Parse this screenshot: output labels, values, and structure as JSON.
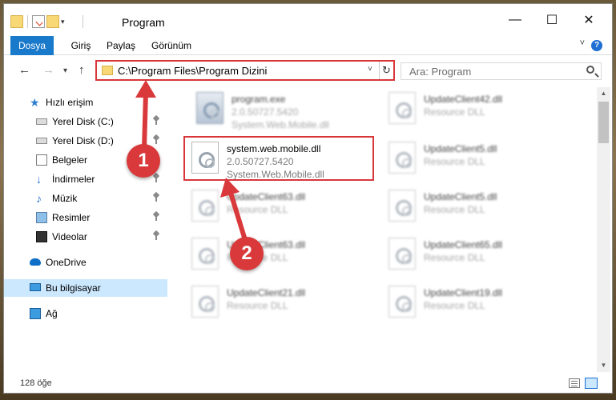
{
  "window": {
    "title": "Program",
    "controls": {
      "minimize": "—",
      "maximize": "☐",
      "close": "✕"
    }
  },
  "ribbon": {
    "tabs": [
      "Dosya",
      "Giriş",
      "Paylaş",
      "Görünüm"
    ],
    "expand_glyph": "˅",
    "help_glyph": "?"
  },
  "navbar": {
    "back": "←",
    "forward": "→",
    "recent": "▾",
    "up": "↑",
    "address": "C:\\Program Files\\Program Dizini",
    "address_dropdown": "˅",
    "refresh": "↻",
    "search_placeholder": "Ara: Program"
  },
  "sidebar": {
    "items": [
      {
        "label": "Hızlı erişim",
        "icon": "star-icon",
        "pinned": false
      },
      {
        "label": "Yerel Disk (C:)",
        "icon": "drive-icon",
        "pinned": true
      },
      {
        "label": "Yerel Disk (D:)",
        "icon": "drive-icon",
        "pinned": true
      },
      {
        "label": "Belgeler",
        "icon": "documents-icon",
        "pinned": true
      },
      {
        "label": "İndirmeler",
        "icon": "download-icon",
        "pinned": true
      },
      {
        "label": "Müzik",
        "icon": "music-icon",
        "pinned": true
      },
      {
        "label": "Resimler",
        "icon": "pictures-icon",
        "pinned": true
      },
      {
        "label": "Videolar",
        "icon": "videos-icon",
        "pinned": true
      },
      {
        "label": "OneDrive",
        "icon": "onedrive-icon",
        "pinned": false
      },
      {
        "label": "Bu bilgisayar",
        "icon": "this-pc-icon",
        "pinned": false,
        "selected": true
      },
      {
        "label": "Ağ",
        "icon": "network-icon",
        "pinned": false
      }
    ]
  },
  "files": [
    {
      "name": "program.exe",
      "line2": "2.0.50727.5420",
      "line3": "System.Web.Mobile.dll"
    },
    {
      "name": "UpdateClient42.dll",
      "line2": "Resource DLL",
      "line3": ""
    },
    {
      "name": "system.web.mobile.dll",
      "line2": "2.0.50727.5420",
      "line3": "System.Web.Mobile.dll"
    },
    {
      "name": "UpdateClient5.dll",
      "line2": "Resource DLL",
      "line3": ""
    },
    {
      "name": "UpdateClient63.dll",
      "line2": "Resource DLL",
      "line3": ""
    },
    {
      "name": "UpdateClient5.dll",
      "line2": "Resource DLL",
      "line3": ""
    },
    {
      "name": "UpdateClient63.dll",
      "line2": "Resource DLL",
      "line3": ""
    },
    {
      "name": "UpdateClient65.dll",
      "line2": "Resource DLL",
      "line3": ""
    },
    {
      "name": "UpdateClient21.dll",
      "line2": "Resource DLL",
      "line3": ""
    },
    {
      "name": "UpdateClient19.dll",
      "line2": "Resource DLL",
      "line3": ""
    }
  ],
  "status": {
    "count": "128 öğe"
  },
  "annotations": {
    "marker1": "1",
    "marker2": "2",
    "color": "#d9393a"
  },
  "colors": {
    "accent": "#1979ca",
    "highlight": "#d8373a",
    "selected_bg": "#cce8ff"
  }
}
